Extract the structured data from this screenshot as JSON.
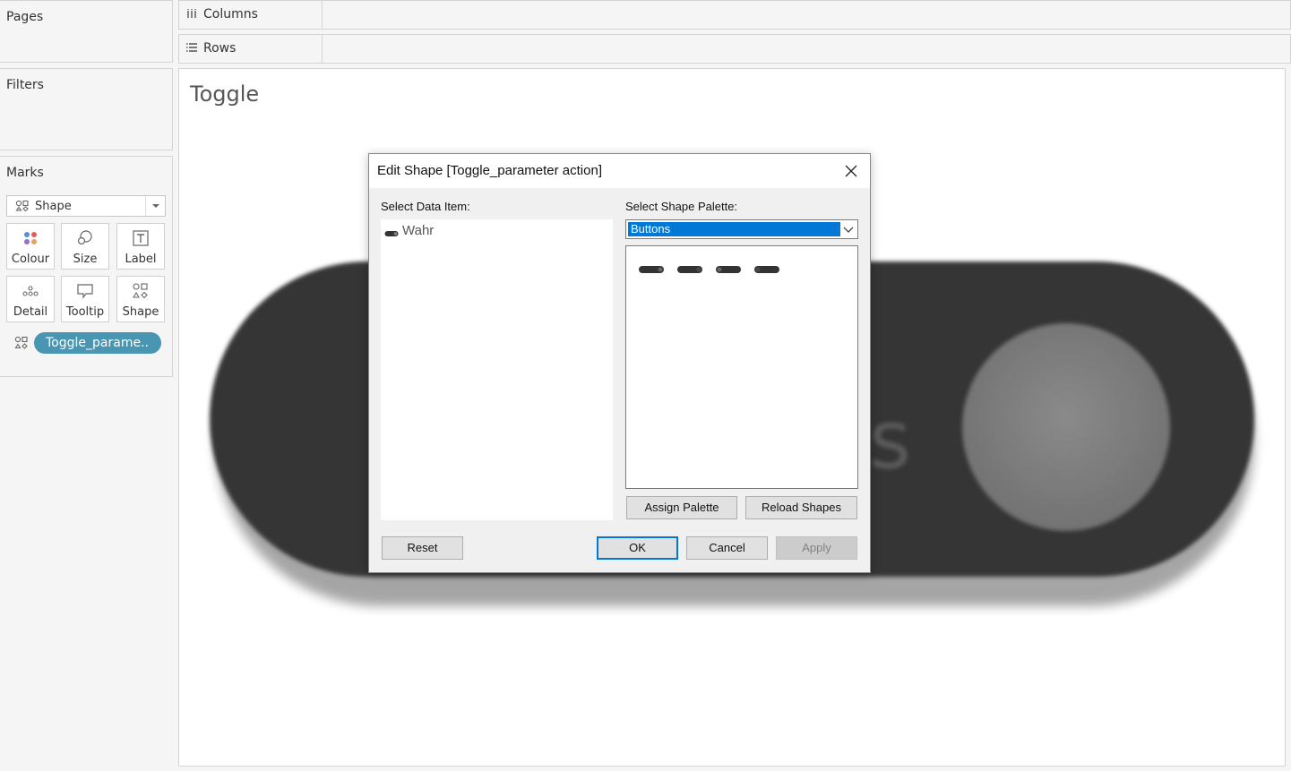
{
  "left_panel": {
    "pages_title": "Pages",
    "filters_title": "Filters",
    "marks": {
      "title": "Marks",
      "mark_type": "Shape",
      "buttons": [
        {
          "label": "Colour",
          "icon": "colour-dots-icon"
        },
        {
          "label": "Size",
          "icon": "size-icon"
        },
        {
          "label": "Label",
          "icon": "label-t-icon"
        },
        {
          "label": "Detail",
          "icon": "detail-dots-icon"
        },
        {
          "label": "Tooltip",
          "icon": "tooltip-icon"
        },
        {
          "label": "Shape",
          "icon": "shape-icon"
        }
      ],
      "pill": {
        "label": "Toggle_parame..",
        "icon": "shape-icon",
        "color": "#4996b2"
      }
    }
  },
  "shelves": {
    "columns_label": "Columns",
    "rows_label": "Rows"
  },
  "worksheet": {
    "title": "Toggle"
  },
  "dialog": {
    "title": "Edit Shape [Toggle_parameter action]",
    "data_item_label": "Select Data Item:",
    "data_items": [
      {
        "label": "Wahr",
        "icon": "toggle-shape-icon"
      }
    ],
    "palette_label": "Select Shape Palette:",
    "palette_value": "Buttons",
    "shapes": [
      "toggle-button-shape-1",
      "toggle-button-shape-2",
      "toggle-button-shape-3",
      "toggle-button-shape-4"
    ],
    "buttons": {
      "assign": "Assign Palette",
      "reload": "Reload Shapes",
      "reset": "Reset",
      "ok": "OK",
      "cancel": "Cancel",
      "apply": "Apply"
    },
    "accent_color": "#0078d7"
  }
}
